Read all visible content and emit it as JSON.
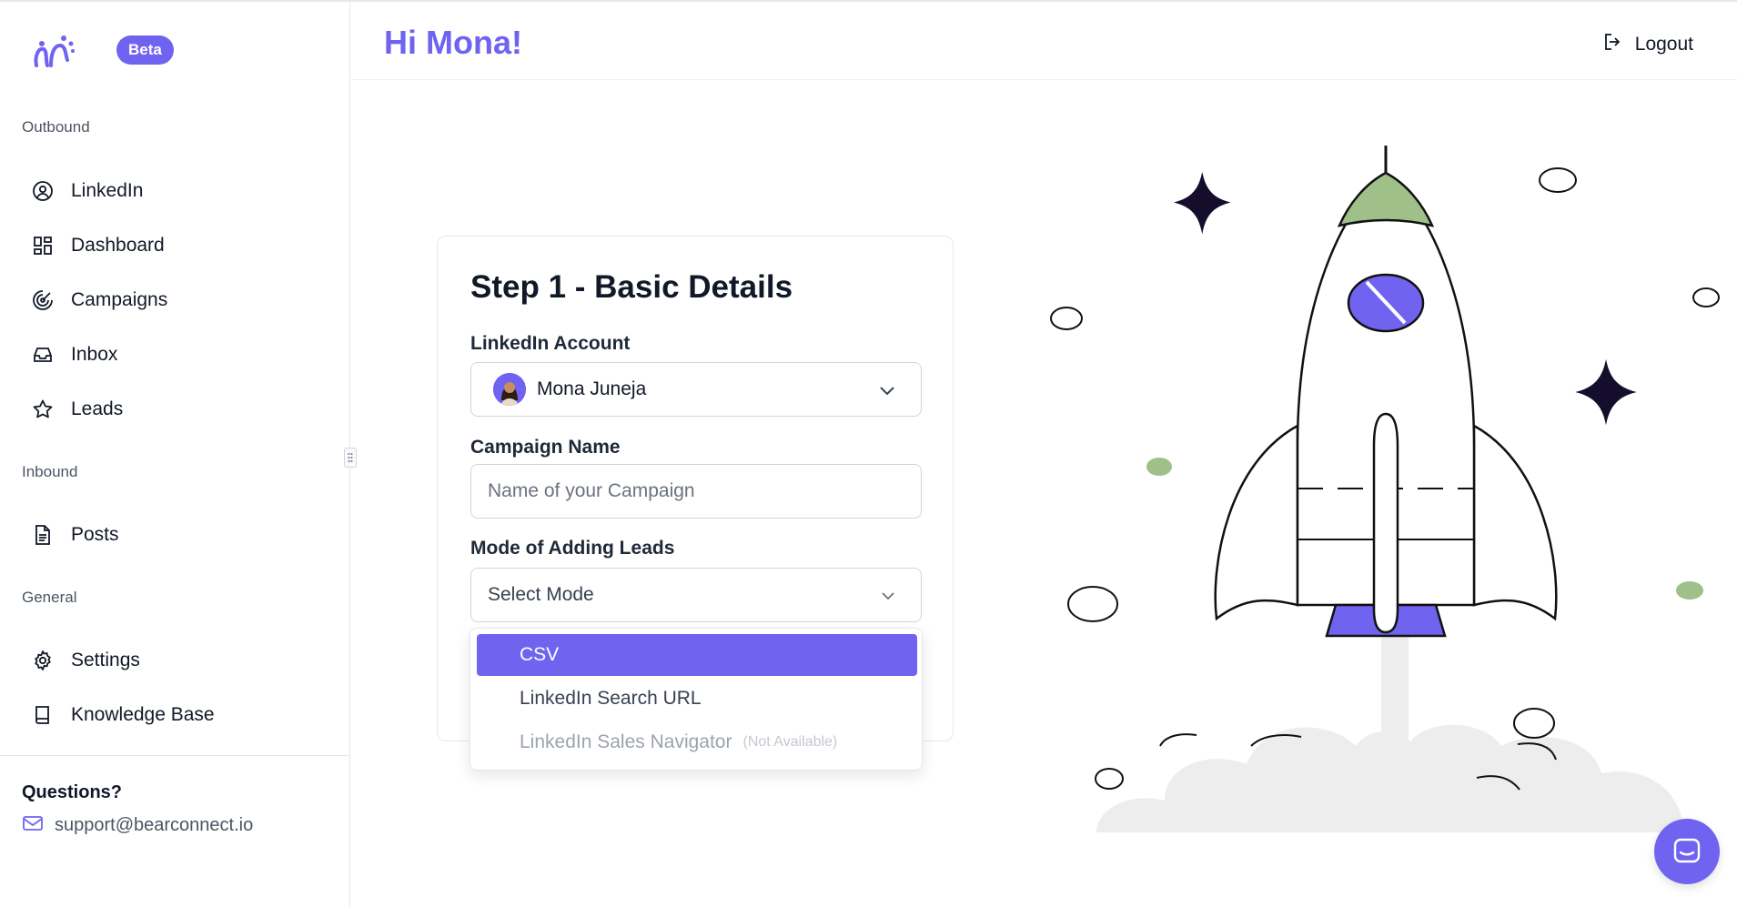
{
  "brand": {
    "badge": "Beta",
    "logo_icon": "bear-paw-logo"
  },
  "sidebar": {
    "sections": {
      "outbound": "Outbound",
      "inbound": "Inbound",
      "general": "General"
    },
    "items": [
      {
        "label": "LinkedIn",
        "icon": "user-circle-icon"
      },
      {
        "label": "Dashboard",
        "icon": "grid-icon"
      },
      {
        "label": "Campaigns",
        "icon": "target-icon"
      },
      {
        "label": "Inbox",
        "icon": "inbox-icon"
      },
      {
        "label": "Leads",
        "icon": "star-icon"
      },
      {
        "label": "Posts",
        "icon": "document-icon"
      },
      {
        "label": "Settings",
        "icon": "gear-icon"
      },
      {
        "label": "Knowledge Base",
        "icon": "book-icon"
      }
    ],
    "questions": "Questions?",
    "support_email": "support@bearconnect.io"
  },
  "header": {
    "greeting": "Hi Mona!",
    "logout": "Logout"
  },
  "form": {
    "title": "Step 1 - Basic Details",
    "account_label": "LinkedIn Account",
    "account_value": "Mona Juneja",
    "campaign_label": "Campaign Name",
    "campaign_placeholder": "Name of your Campaign",
    "mode_label": "Mode of Adding Leads",
    "mode_value": "Select Mode",
    "mode_options": [
      {
        "label": "CSV",
        "state": "active"
      },
      {
        "label": "LinkedIn Search URL",
        "state": "normal"
      },
      {
        "label": "LinkedIn Sales Navigator",
        "state": "disabled",
        "note": "(Not Available)"
      }
    ]
  },
  "colors": {
    "accent": "#6f63f0",
    "rocket_green": "#9fc089",
    "smoke": "#ededed"
  }
}
